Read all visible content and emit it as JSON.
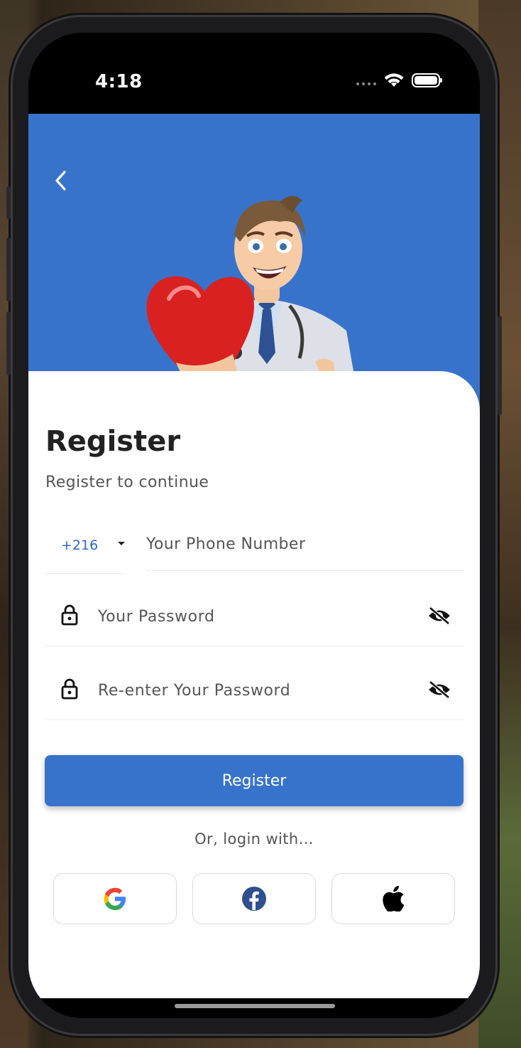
{
  "status_bar": {
    "time": "4:18"
  },
  "hero": {
    "back_icon": "chevron-left-icon",
    "illustration": "doctor-holding-heart"
  },
  "form": {
    "title": "Register",
    "subtitle": "Register to continue",
    "country_code": "+216",
    "phone_placeholder": "Your Phone Number",
    "password_placeholder": "Your Password",
    "reenter_password_placeholder": "Re-enter Your Password",
    "register_label": "Register",
    "or_login_with": "Or, login with..."
  },
  "social": [
    {
      "name": "google",
      "icon": "google-icon"
    },
    {
      "name": "facebook",
      "icon": "facebook-icon"
    },
    {
      "name": "apple",
      "icon": "apple-icon"
    }
  ],
  "colors": {
    "primary": "#3873cb",
    "text_dark": "#222222",
    "text_muted": "#555555",
    "link_blue": "#2f66d0"
  }
}
